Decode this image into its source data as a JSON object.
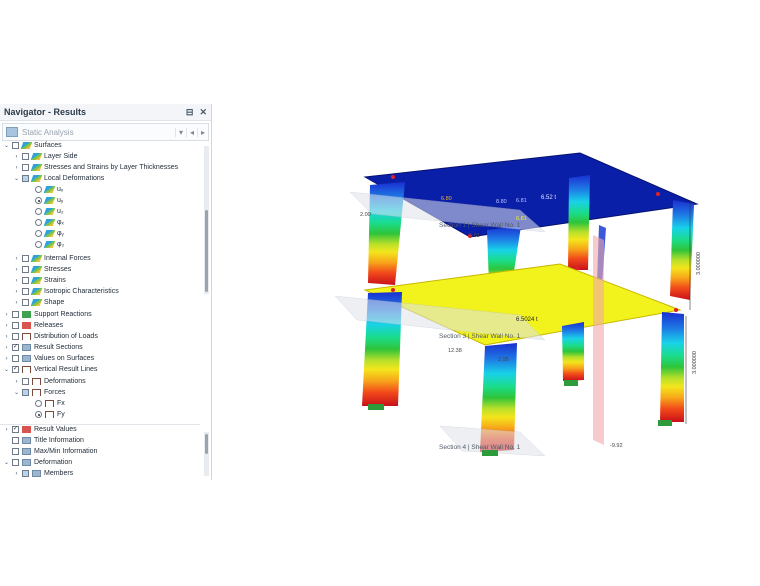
{
  "navigator": {
    "title": "Navigator - Results",
    "pin_icon": "pin-icon",
    "close_icon": "close-icon",
    "close_label": "✕",
    "pin_label": "⊟",
    "analysis": "Static Analysis",
    "items": [
      {
        "label": "Surfaces",
        "checked": false
      },
      {
        "label": "Layer Side"
      },
      {
        "label": "Stresses and Strains by Layer Thicknesses"
      },
      {
        "label": "Local Deformations"
      },
      {
        "label": "uₓ"
      },
      {
        "label": "uᵧ"
      },
      {
        "label": "u₂"
      },
      {
        "label": "φₓ"
      },
      {
        "label": "φᵧ"
      },
      {
        "label": "φ₂"
      },
      {
        "label": "Internal Forces"
      },
      {
        "label": "Stresses"
      },
      {
        "label": "Strains"
      },
      {
        "label": "Isotropic Characteristics"
      },
      {
        "label": "Shape"
      },
      {
        "label": "Support Reactions"
      },
      {
        "label": "Releases"
      },
      {
        "label": "Distribution of Loads"
      },
      {
        "label": "Result Sections"
      },
      {
        "label": "Values on Surfaces"
      },
      {
        "label": "Vertical Result Lines"
      },
      {
        "label": "Deformations"
      },
      {
        "label": "Forces"
      },
      {
        "label": "Fx"
      },
      {
        "label": "Fy"
      },
      {
        "label": "Result Values"
      },
      {
        "label": "Title Information"
      },
      {
        "label": "Max/Min Information"
      },
      {
        "label": "Deformation"
      },
      {
        "label": "Members"
      }
    ]
  },
  "model": {
    "section_1": "Section 1 | Shear Wall No. 1",
    "section_3": "Section 3 | Shear Wall No. 1",
    "section_4": "Section 4 | Shear Wall No. 1",
    "value_top": "6.52 t",
    "value_mid": "6.5024 t",
    "v1": "6.80",
    "v2": "8.80",
    "v3": "6.81",
    "v4": "6.81",
    "v5": "5.81",
    "v6": "2.00",
    "v7": "12.38",
    "v8": "2.95",
    "v9": "-9.92",
    "dim_top": "3.000000",
    "dim_bottom": "3.000000"
  },
  "colors": {
    "slab_top": "#0a1fa8",
    "slab_mid": "#f2f21c",
    "accent": "#2f8fd8"
  }
}
